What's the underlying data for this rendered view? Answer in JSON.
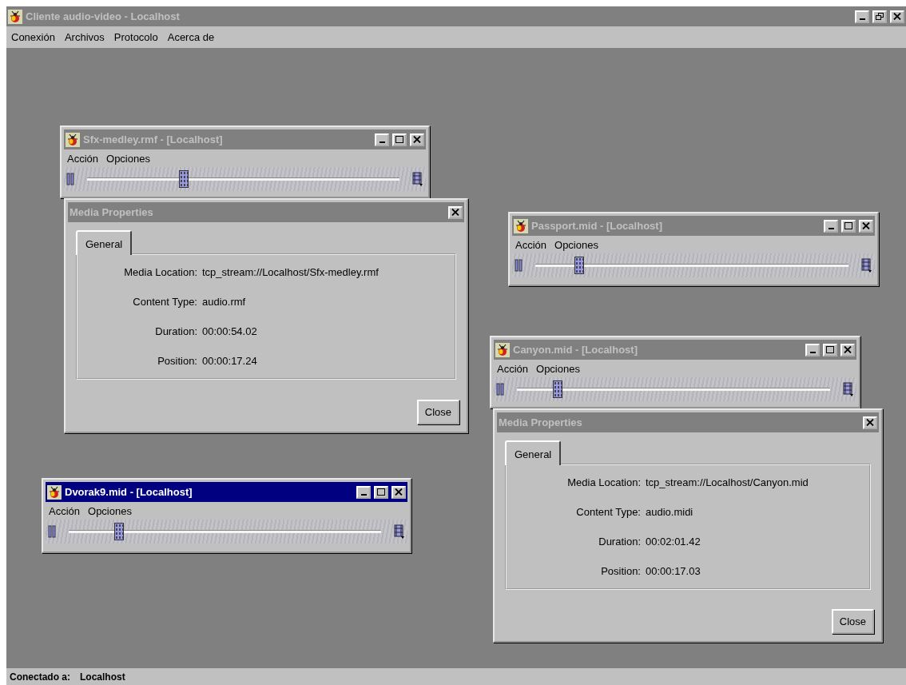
{
  "window": {
    "title": "Cliente audio-video - Localhost"
  },
  "menu": [
    "Conexión",
    "Archivos",
    "Protocolo",
    "Acerca de"
  ],
  "windows": [
    {
      "kind": "player",
      "title": "Sfx-medley.rmf - [Localhost]",
      "active": false,
      "menu": [
        "Acción",
        "Opciones"
      ],
      "level": 0.31
    },
    {
      "kind": "properties",
      "title": "Media Properties",
      "active": false,
      "tab": {
        "label": "General",
        "selected": true
      },
      "fields": [
        {
          "label": "Media Location:",
          "value": "tcp_stream://Localhost/Sfx-medley.rmf"
        },
        {
          "label": "Content Type:",
          "value": "audio.rmf"
        },
        {
          "label": "Duration:",
          "value": "00:00:54.02"
        },
        {
          "label": "Position:",
          "value": "00:00:17.24"
        }
      ],
      "button": "Close"
    },
    {
      "kind": "player",
      "title": "Passport.mid - [Localhost]",
      "active": false,
      "menu": [
        "Acción",
        "Opciones"
      ],
      "level": 0.14
    },
    {
      "kind": "player",
      "title": "Canyon.mid - [Localhost]",
      "active": false,
      "menu": [
        "Acción",
        "Opciones"
      ],
      "level": 0.13
    },
    {
      "kind": "properties",
      "title": "Media Properties",
      "active": false,
      "tab": {
        "label": "General",
        "selected": true
      },
      "fields": [
        {
          "label": "Media Location:",
          "value": "tcp_stream://Localhost/Canyon.mid"
        },
        {
          "label": "Content Type:",
          "value": "audio.midi"
        },
        {
          "label": "Duration:",
          "value": "00:02:01.42"
        },
        {
          "label": "Position:",
          "value": "00:00:17.03"
        }
      ],
      "button": "Close"
    },
    {
      "kind": "player",
      "title": "Dvorak9.mid - [Localhost]",
      "active": true,
      "menu": [
        "Acción",
        "Opciones"
      ],
      "level": 0.16
    }
  ],
  "status_bar": {
    "label": "Conectado a:",
    "value": "Localhost"
  }
}
